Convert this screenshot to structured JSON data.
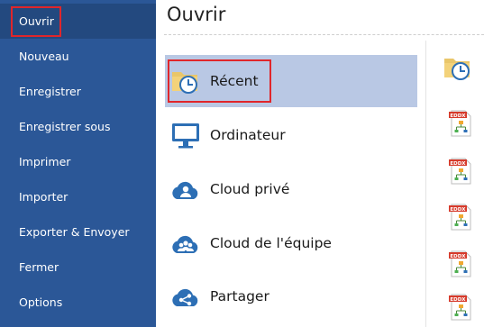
{
  "sidebar": {
    "items": [
      {
        "label": "Ouvrir",
        "active": true
      },
      {
        "label": "Nouveau"
      },
      {
        "label": "Enregistrer"
      },
      {
        "label": "Enregistrer sous"
      },
      {
        "label": "Imprimer"
      },
      {
        "label": "Importer"
      },
      {
        "label": "Exporter & Envoyer"
      },
      {
        "label": "Fermer"
      },
      {
        "label": "Options"
      }
    ]
  },
  "main": {
    "title": "Ouvrir",
    "locations": [
      {
        "label": "Récent",
        "icon": "recent-folder-clock-icon",
        "selected": true
      },
      {
        "label": "Ordinateur",
        "icon": "computer-monitor-icon"
      },
      {
        "label": "Cloud privé",
        "icon": "cloud-person-icon"
      },
      {
        "label": "Cloud de l'équipe",
        "icon": "cloud-team-icon"
      },
      {
        "label": "Partager",
        "icon": "share-cloud-icon"
      }
    ]
  },
  "recent_files": {
    "header_icon": "recent-folder-clock-icon",
    "file_badge": "EDDX",
    "file_icon": "eddx-file-icon"
  },
  "colors": {
    "sidebar_bg": "#2b5797",
    "selected_bg": "#b9c8e4",
    "highlight_border": "#e0262b",
    "icon_blue": "#2d6fb5"
  }
}
